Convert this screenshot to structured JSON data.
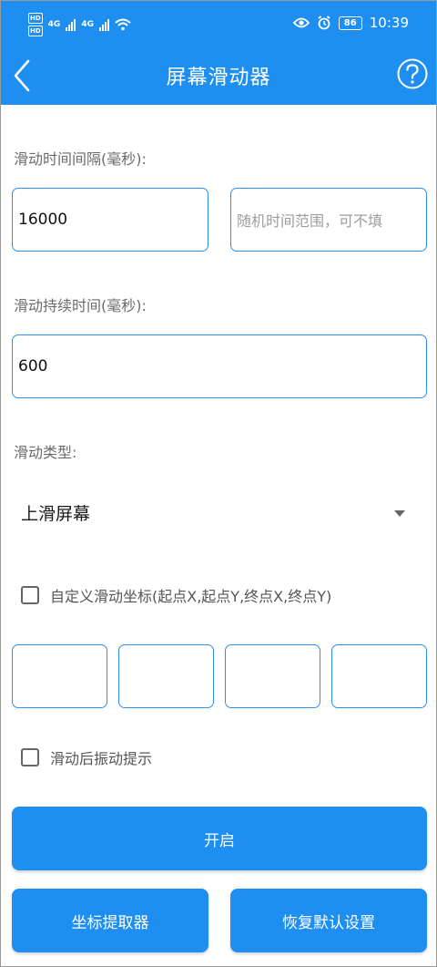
{
  "status_bar": {
    "hd_label": "HD",
    "network_1": "4G",
    "network_2": "4G",
    "battery": "86",
    "time": "10:39"
  },
  "header": {
    "title": "屏幕滑动器"
  },
  "form": {
    "interval_label": "滑动时间间隔(毫秒):",
    "interval_value": "16000",
    "random_placeholder": "随机时间范围，可不填",
    "duration_label": "滑动持续时间(毫秒):",
    "duration_value": "600",
    "type_label": "滑动类型:",
    "type_selected": "上滑屏幕",
    "custom_coords_label": "自定义滑动坐标(起点X,起点Y,终点X,终点Y)",
    "vibrate_label": "滑动后振动提示"
  },
  "buttons": {
    "start": "开启",
    "picker": "坐标提取器",
    "reset": "恢复默认设置"
  },
  "colors": {
    "primary": "#1e8ff0",
    "field_border": "#2f8ff0"
  }
}
